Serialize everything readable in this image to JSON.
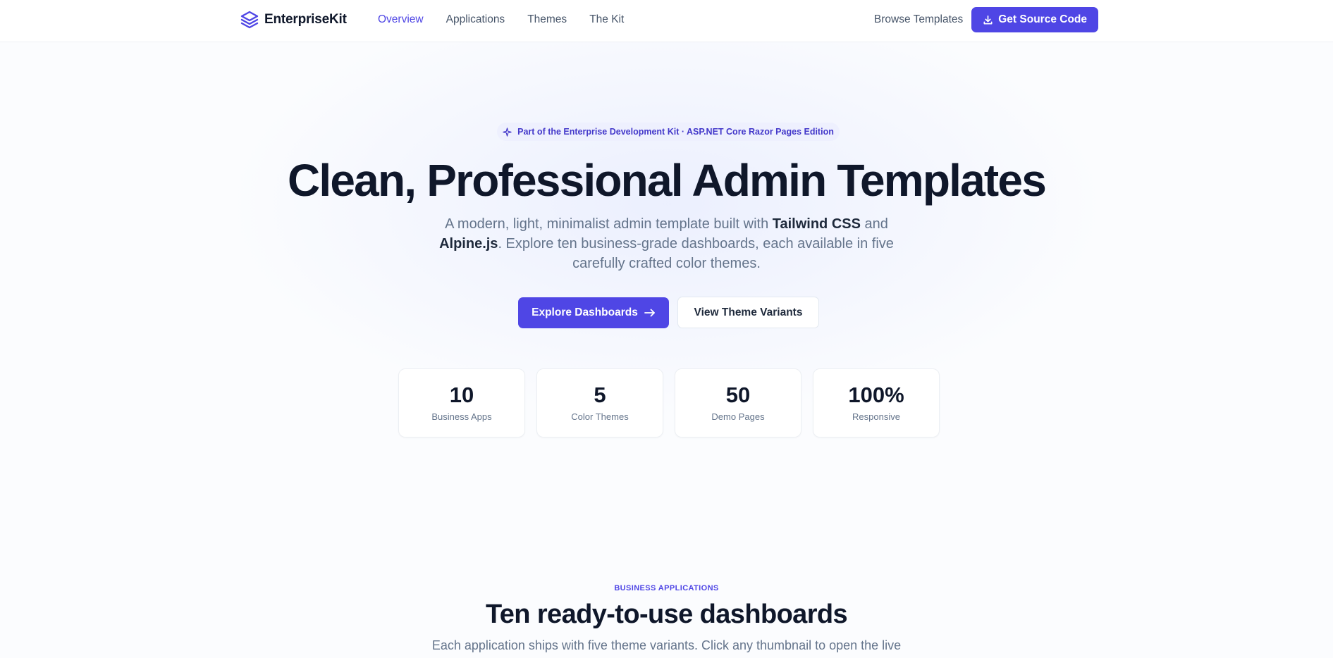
{
  "nav": {
    "brand": "EnterpriseKit",
    "links": [
      {
        "label": "Overview",
        "active": true
      },
      {
        "label": "Applications",
        "active": false
      },
      {
        "label": "Themes",
        "active": false
      },
      {
        "label": "The Kit",
        "active": false
      }
    ],
    "browse_label": "Browse Templates",
    "cta_label": "Get Source Code"
  },
  "hero": {
    "pill_text": "Part of the Enterprise Development Kit · ASP.NET Core Razor Pages Edition",
    "title": "Clean, Professional Admin Templates",
    "subtitle_parts": {
      "p1": "A modern, light, minimalist admin template built with ",
      "b1": "Tailwind CSS",
      "p2": " and ",
      "b2": "Alpine.js",
      "p3": ". Explore ten business-grade dashboards, each available in five carefully crafted color themes."
    },
    "primary_cta": "Explore Dashboards",
    "secondary_cta": "View Theme Variants"
  },
  "stats": [
    {
      "value": "10",
      "label": "Business Apps"
    },
    {
      "value": "5",
      "label": "Color Themes"
    },
    {
      "value": "50",
      "label": "Demo Pages"
    },
    {
      "value": "100%",
      "label": "Responsive"
    }
  ],
  "section": {
    "eyebrow": "BUSINESS APPLICATIONS",
    "title": "Ten ready-to-use dashboards",
    "subtitle": "Each application ships with five theme variants. Click any thumbnail to open the live"
  },
  "colors": {
    "accent": "#4f46e5",
    "text_dark": "#0f172a",
    "text_muted": "#64748b"
  },
  "icons": {
    "brand": "layers-icon",
    "download": "download-icon",
    "sparkle": "sparkle-icon",
    "arrow": "arrow-right-icon"
  }
}
